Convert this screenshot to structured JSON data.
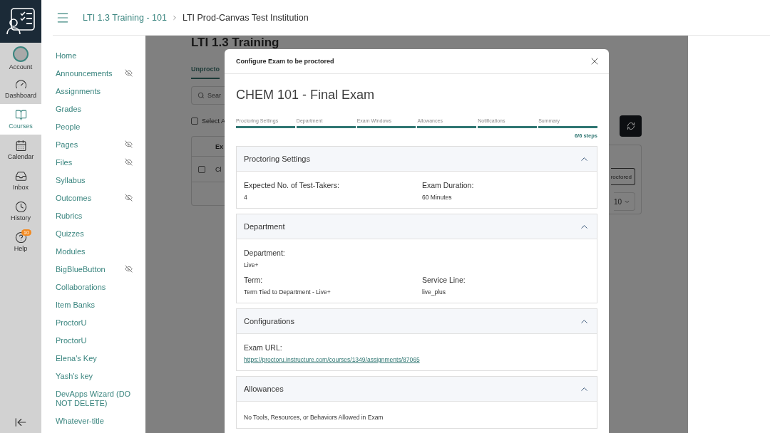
{
  "global_nav": {
    "items": [
      {
        "kind": "account",
        "label": "Account",
        "selected": false
      },
      {
        "kind": "dashboard",
        "label": "Dashboard",
        "selected": false
      },
      {
        "kind": "courses",
        "label": "Courses",
        "selected": true
      },
      {
        "kind": "calendar",
        "label": "Calendar",
        "selected": false
      },
      {
        "kind": "inbox",
        "label": "Inbox",
        "selected": false
      },
      {
        "kind": "history",
        "label": "History",
        "selected": false
      },
      {
        "kind": "help",
        "label": "Help",
        "selected": false,
        "badge": "10"
      }
    ]
  },
  "breadcrumb": [
    {
      "label": "LTI 1.3 Training - 101",
      "current": false
    },
    {
      "label": "LTI Prod-Canvas Test Institution",
      "current": true
    }
  ],
  "course_nav": {
    "items": [
      {
        "label": "Home",
        "hidden": false
      },
      {
        "label": "Announcements",
        "hidden": true
      },
      {
        "label": "Assignments",
        "hidden": false
      },
      {
        "label": "Grades",
        "hidden": false
      },
      {
        "label": "People",
        "hidden": false
      },
      {
        "label": "Pages",
        "hidden": true
      },
      {
        "label": "Files",
        "hidden": true
      },
      {
        "label": "Syllabus",
        "hidden": false
      },
      {
        "label": "Outcomes",
        "hidden": true
      },
      {
        "label": "Rubrics",
        "hidden": false
      },
      {
        "label": "Quizzes",
        "hidden": false
      },
      {
        "label": "Modules",
        "hidden": false
      },
      {
        "label": "BigBlueButton",
        "hidden": true
      },
      {
        "label": "Collaborations",
        "hidden": false
      },
      {
        "label": "Item Banks",
        "hidden": false
      },
      {
        "label": "ProctorU",
        "hidden": false
      },
      {
        "label": "ProctorU",
        "hidden": false
      },
      {
        "label": "Elena's Key",
        "hidden": false
      },
      {
        "label": "Yash's key",
        "hidden": false
      },
      {
        "label": "DevApps Wizard (DO NOT DELETE)",
        "hidden": false
      },
      {
        "label": "Whatever-title",
        "hidden": false
      }
    ]
  },
  "background_page": {
    "title": "LTI 1.3 Training",
    "tab": {
      "label": "Unprocto",
      "selected": true
    },
    "search": {
      "placeholder": "Sear"
    },
    "select_all": {
      "label": "Select A",
      "checked": false
    },
    "table": {
      "column_1": "Ex",
      "row_checked": false,
      "row_cell": "Cl",
      "row_button": "roctored",
      "page_size": "10"
    }
  },
  "modal": {
    "title": "Configure Exam to be proctored",
    "exam_title": "CHEM 101 - Final Exam",
    "steps": [
      {
        "label": "Proctoring Settings",
        "completed": true
      },
      {
        "label": "Department",
        "completed": true
      },
      {
        "label": "Exam Windows",
        "completed": true
      },
      {
        "label": "Allowances",
        "completed": true
      },
      {
        "label": "Notifications",
        "completed": true
      },
      {
        "label": "Summary",
        "completed": true
      }
    ],
    "step_count": "6/6 steps",
    "sections": [
      {
        "title": "Proctoring Settings",
        "expanded": true,
        "rows": [
          [
            {
              "label": "Expected No. of Test-Takers:",
              "value": "4",
              "kind": "text"
            },
            {
              "label": "Exam Duration:",
              "value": "60 Minutes",
              "kind": "text"
            }
          ]
        ]
      },
      {
        "title": "Department",
        "expanded": true,
        "rows": [
          [
            {
              "label": "Department:",
              "value": "Live+",
              "kind": "text"
            }
          ],
          [
            {
              "label": "Term:",
              "value": "Term Tied to Department - Live+",
              "kind": "text"
            },
            {
              "label": "Service Line:",
              "value": "live_plus",
              "kind": "text"
            }
          ]
        ]
      },
      {
        "title": "Configurations",
        "expanded": true,
        "rows": [
          [
            {
              "label": "Exam URL:",
              "value": "https://proctoru.instructure.com/courses/1349/assignments/87065",
              "kind": "link"
            }
          ]
        ]
      },
      {
        "title": "Allowances",
        "expanded": true,
        "note": "No Tools, Resources, or Behaviors Allowed in Exam"
      }
    ]
  }
}
